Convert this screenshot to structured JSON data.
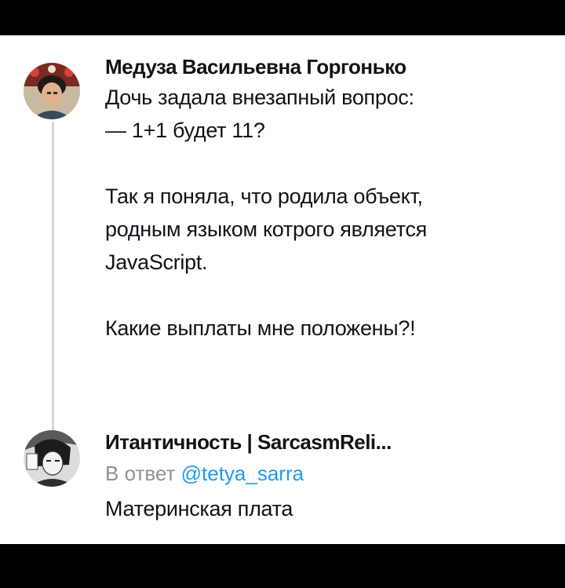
{
  "tweets": [
    {
      "author": "Медуза Васильевна Горгонько",
      "lines": [
        "Дочь задала внезапный вопрос:",
        "— 1+1 будет 11?",
        "",
        "Так я поняла, что родила объект,",
        "родным языком котрого является",
        "JavaScript.",
        "",
        "Какие выплаты мне положены?!"
      ]
    },
    {
      "author": "Итантичность | SarcasmReli...",
      "reply_prefix": "В ответ",
      "reply_mention": "@tetya_sarra",
      "lines": [
        "Материнская плата"
      ]
    }
  ],
  "colors": {
    "text": "#0f1419",
    "muted": "#8a9199",
    "link": "#1d9bf0",
    "thread_line": "#cfd9de",
    "frame": "#000000"
  }
}
